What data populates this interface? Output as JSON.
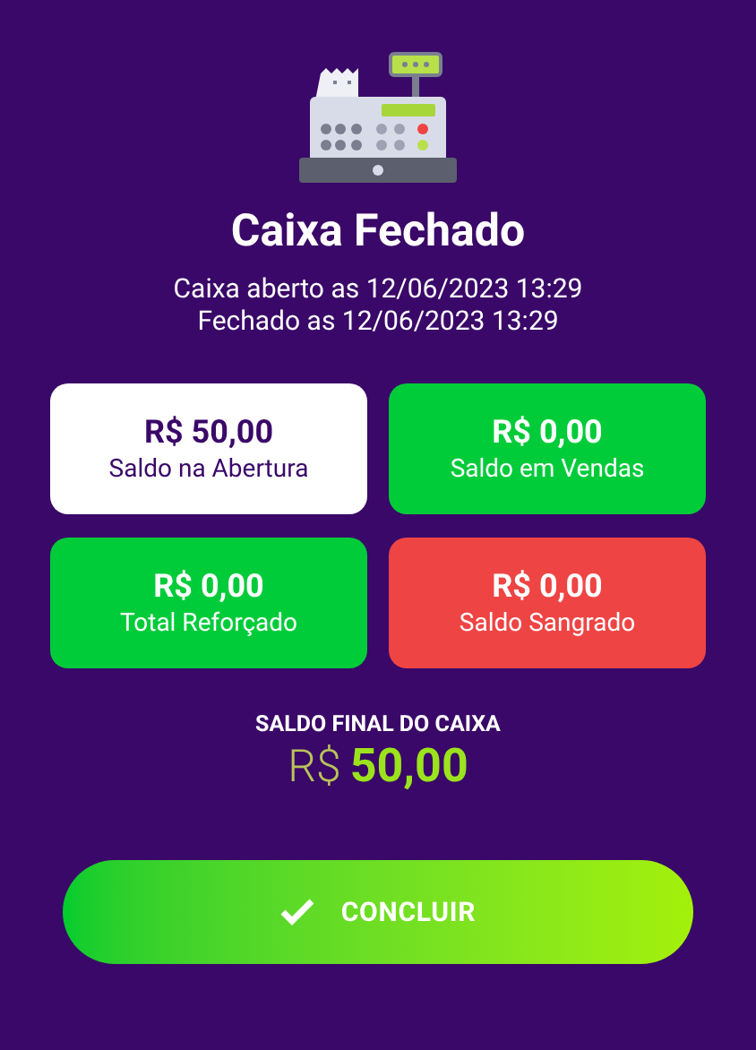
{
  "title": "Caixa Fechado",
  "info_lines": [
    "Caixa aberto as 12/06/2023 13:29",
    "Fechado as 12/06/2023 13:29"
  ],
  "cards": [
    {
      "value": "R$ 50,00",
      "label": "Saldo na Abertura",
      "kind": "opening"
    },
    {
      "value": "R$ 0,00",
      "label": "Saldo em Vendas",
      "kind": "credit"
    },
    {
      "value": "R$ 0,00",
      "label": "Total Reforçado",
      "kind": "credit"
    },
    {
      "value": "R$ 0,00",
      "label": "Saldo Sangrado",
      "kind": "debit"
    }
  ],
  "final_balance": {
    "label": "SALDO FINAL DO CAIXA",
    "currency": "R$",
    "amount": "50,00"
  },
  "button": {
    "label": "CONCLUIR"
  }
}
